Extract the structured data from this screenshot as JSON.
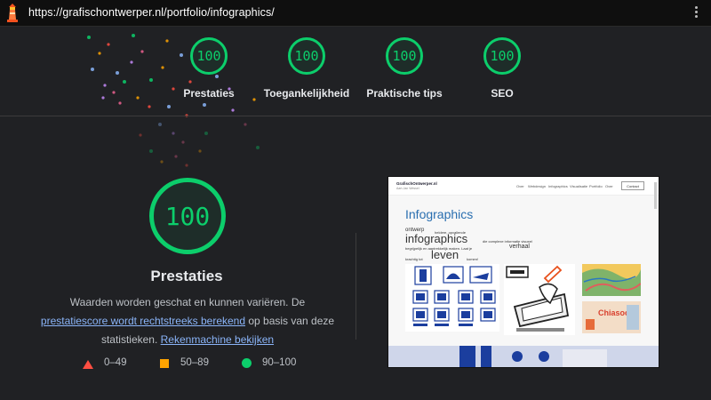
{
  "browser": {
    "url": "https://grafischontwerper.nl/portfolio/infographics/",
    "logo_icon": "lighthouse-icon",
    "menu_icon": "kebab-menu-icon"
  },
  "summary_scores": [
    {
      "score": "100",
      "label": "Prestaties"
    },
    {
      "score": "100",
      "label": "Toegankelijkheid"
    },
    {
      "score": "100",
      "label": "Praktische tips"
    },
    {
      "score": "100",
      "label": "SEO"
    }
  ],
  "performance": {
    "score": "100",
    "title": "Prestaties",
    "desc_prefix": "Waarden worden geschat en kunnen variëren. De ",
    "desc_link1": "prestatiescore wordt rechtstreeks berekend",
    "desc_middle": " op basis van deze statistieken. ",
    "desc_link2": "Rekenmachine bekijken"
  },
  "legend": {
    "fail": "0–49",
    "average": "50–89",
    "pass": "90–100"
  },
  "screenshot": {
    "site_name": "GrafischOntwerper.nl",
    "site_tagline": "Aart-Jan Wessel",
    "nav": [
      "Over",
      "Webdesign",
      "Infographics",
      "Visualisatie",
      "Portfolio",
      "Over",
      "Contact"
    ],
    "heading": "Infographics",
    "words": {
      "ontwerp": "ontwerp",
      "heldere": "heldere, opvallende",
      "infographics": "infographics",
      "complexe": "die complexe informatie visueel",
      "begrijpelijk": "begrijpelijk en aantrekkelijk maken. Laat je",
      "verhaal": "verhaal",
      "krachtig": "krachtig tot",
      "leven": "leven",
      "komen": "komen!"
    },
    "badge": "Chiasoos"
  },
  "colors": {
    "pass": "#0cce6b",
    "average": "#ffa400",
    "fail": "#ff4e42",
    "link": "#8ab4f8",
    "background": "#202124"
  }
}
